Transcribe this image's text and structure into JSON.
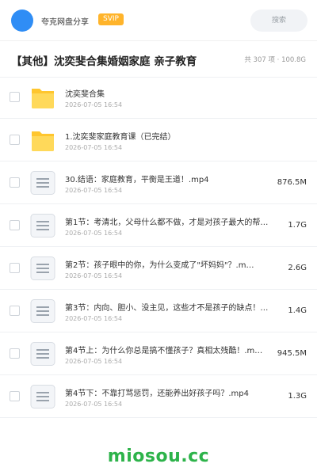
{
  "header": {
    "brand": "夸克网盘分享",
    "badge": "SVIP",
    "search_placeholder": "搜索"
  },
  "folder": {
    "title": "【其他】沈奕斐合集婚姻家庭 亲子教育",
    "summary": "共 307 项 · 100.8G"
  },
  "files": [
    {
      "type": "folder",
      "name": "沈奕斐合集",
      "date": "2026-07-05 16:54",
      "size": ""
    },
    {
      "type": "folder",
      "name": "1.沈奕斐家庭教育课（已完结）",
      "date": "2026-07-05 16:54",
      "size": ""
    },
    {
      "type": "file",
      "name": "30.结语：家庭教育，平衡是王道！.mp4",
      "date": "2026-07-05 16:54",
      "size": "876.5M"
    },
    {
      "type": "file",
      "name": "第1节：考清北，父母什么都不做，才是对孩子最大的帮…",
      "date": "2026-07-05 16:54",
      "size": "1.7G"
    },
    {
      "type": "file",
      "name": "第2节：孩子眼中的你，为什么变成了\"坏妈妈\"？.m…",
      "date": "2026-07-05 16:54",
      "size": "2.6G"
    },
    {
      "type": "file",
      "name": "第3节：内向、胆小、没主见，这些才不是孩子的缺点！…",
      "date": "2026-07-05 16:54",
      "size": "1.4G"
    },
    {
      "type": "file",
      "name": "第4节上：为什么你总是搞不懂孩子？真相太残酷！.m…",
      "date": "2026-07-05 16:54",
      "size": "945.5M"
    },
    {
      "type": "file",
      "name": "第4节下：不靠打骂惩罚，还能养出好孩子吗？.mp4",
      "date": "2026-07-05 16:54",
      "size": "1.3G"
    }
  ],
  "watermark": "miosou.cc",
  "colors": {
    "avatar": "#2f8df5",
    "badge": "#ffb42b",
    "folder": "#ffc62e",
    "watermark": "#2db34a"
  }
}
